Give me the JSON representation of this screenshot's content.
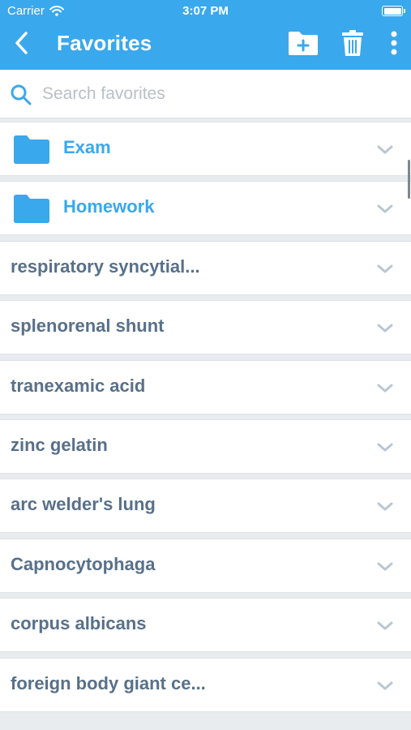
{
  "status_bar": {
    "carrier": "Carrier",
    "time": "3:07 PM"
  },
  "nav": {
    "title": "Favorites",
    "icons": {
      "back": "chevron-left-icon",
      "add_folder": "folder-plus-icon",
      "delete": "trash-icon",
      "more": "more-vertical-icon"
    }
  },
  "search": {
    "placeholder": "Search favorites",
    "value": ""
  },
  "folders": [
    {
      "label": "Exam"
    },
    {
      "label": "Homework"
    }
  ],
  "items": [
    {
      "label": "respiratory syncytial..."
    },
    {
      "label": "splenorenal shunt"
    },
    {
      "label": "tranexamic acid"
    },
    {
      "label": "zinc gelatin"
    },
    {
      "label": "arc welder's lung"
    },
    {
      "label": "Capnocytophaga"
    },
    {
      "label": "corpus albicans"
    },
    {
      "label": "foreign body giant ce..."
    }
  ],
  "colors": {
    "accent": "#3aa8ec",
    "item_text": "#58708a",
    "chevron": "#b9c7d4",
    "background": "#e9ecef"
  }
}
